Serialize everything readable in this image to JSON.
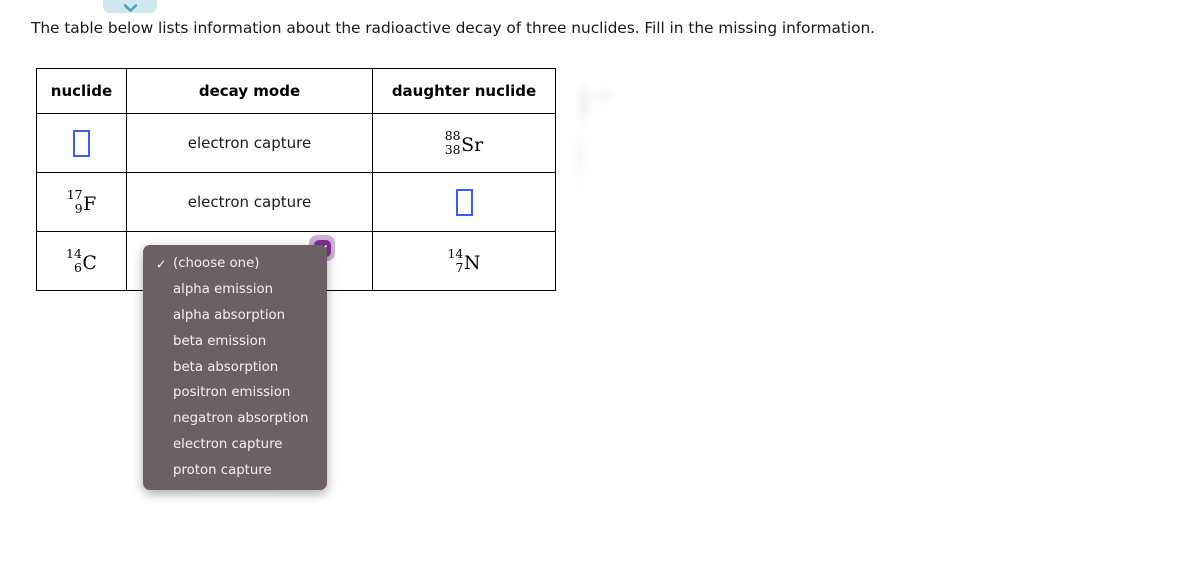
{
  "prompt": "The table below lists information about the radioactive decay of three nuclides. Fill in the missing information.",
  "top_widget": {
    "name": "teal-chevron-pill",
    "icon": "chevron-down-icon",
    "fill_color": "#cfe8ef",
    "icon_color": "#4aa3bd"
  },
  "table": {
    "headers": [
      "nuclide",
      "decay mode",
      "daughter nuclide"
    ],
    "rows": [
      {
        "nuclide": {
          "type": "input",
          "value": "",
          "mass": "",
          "atomic": "",
          "symbol": ""
        },
        "decay_mode": {
          "type": "text",
          "value": "electron capture"
        },
        "daughter": {
          "type": "isotope",
          "mass": "88",
          "atomic": "38",
          "symbol": "Sr"
        }
      },
      {
        "nuclide": {
          "type": "isotope",
          "mass": "17",
          "atomic": "9",
          "symbol": "F"
        },
        "decay_mode": {
          "type": "text",
          "value": "electron capture"
        },
        "daughter": {
          "type": "input",
          "value": ""
        }
      },
      {
        "nuclide": {
          "type": "isotope",
          "mass": "14",
          "atomic": "6",
          "symbol": "C"
        },
        "decay_mode": {
          "type": "select",
          "value": "(choose one)"
        },
        "daughter": {
          "type": "isotope",
          "mass": "14",
          "atomic": "7",
          "symbol": "N"
        }
      }
    ]
  },
  "dropdown": {
    "open": true,
    "selected": "(choose one)",
    "check_glyph": "✓",
    "background_color": "#6b6165",
    "options": [
      "(choose one)",
      "alpha emission",
      "alpha absorption",
      "beta emission",
      "beta absorption",
      "positron emission",
      "negatron absorption",
      "electron capture",
      "proton capture"
    ]
  },
  "select_badge": {
    "icon": "chevron-down-icon",
    "ring_color": "#cdaed4",
    "fill_color": "#7d2f8c"
  },
  "colors": {
    "input_border": "#3b5bfd",
    "table_border": "#000000",
    "text": "#1a1a1a"
  }
}
